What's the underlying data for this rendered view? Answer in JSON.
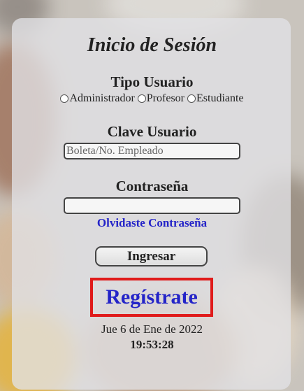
{
  "login": {
    "title": "Inicio de Sesión",
    "user_type_heading": "Tipo Usuario",
    "user_types": [
      "Administrador",
      "Profesor",
      "Estudiante"
    ],
    "user_key_heading": "Clave Usuario",
    "user_key_placeholder": "Boleta/No. Empleado",
    "user_key_value": "",
    "password_heading": "Contraseña",
    "password_value": "",
    "forgot_link": "Olvidaste Contraseña",
    "login_button": "Ingresar",
    "register_link": "Regístrate",
    "date": "Jue 6 de Ene de 2022",
    "time": "19:53:28"
  },
  "colors": {
    "link": "#2424c8",
    "register_border": "#e01b1b"
  }
}
